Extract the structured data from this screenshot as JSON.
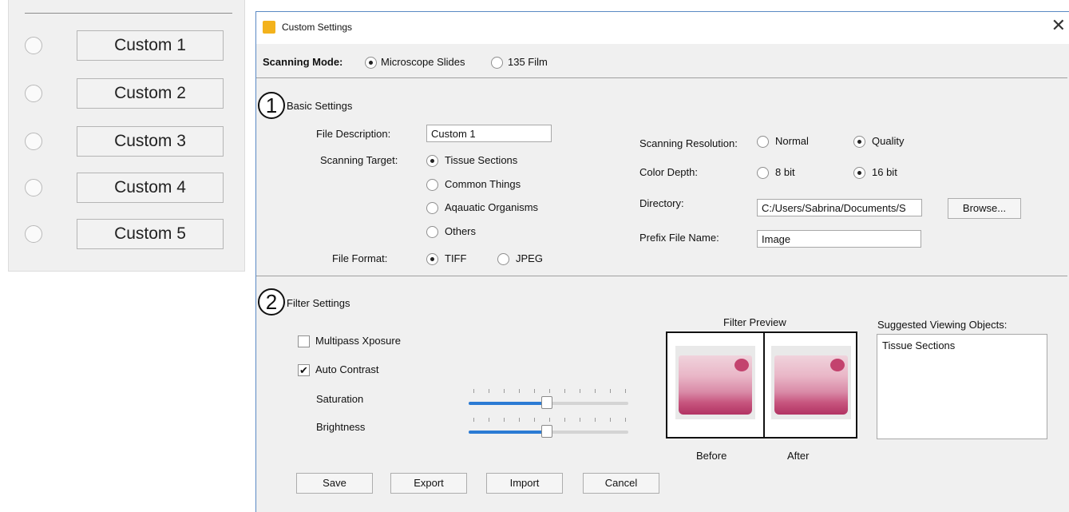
{
  "left_panel": {
    "items": [
      {
        "label": "Custom 1"
      },
      {
        "label": "Custom 2"
      },
      {
        "label": "Custom 3"
      },
      {
        "label": "Custom 4"
      },
      {
        "label": "Custom 5"
      }
    ]
  },
  "dialog": {
    "title": "Custom Settings",
    "close_icon": "close-icon",
    "scanning_mode": {
      "label": "Scanning Mode:",
      "options": [
        "Microscope Slides",
        "135 Film"
      ],
      "selected": "Microscope Slides"
    },
    "basic": {
      "number": "1",
      "title": "Basic Settings",
      "file_description": {
        "label": "File Description:",
        "value": "Custom 1"
      },
      "scanning_target": {
        "label": "Scanning Target:",
        "options": [
          "Tissue Sections",
          "Common Things",
          "Aqauatic Organisms",
          "Others"
        ],
        "selected": "Tissue Sections"
      },
      "file_format": {
        "label": "File Format:",
        "options": [
          "TIFF",
          "JPEG"
        ],
        "selected": "TIFF"
      },
      "scanning_resolution": {
        "label": "Scanning Resolution:",
        "options": [
          "Normal",
          "Quality"
        ],
        "selected": "Quality"
      },
      "color_depth": {
        "label": "Color Depth:",
        "options": [
          "8 bit",
          "16 bit"
        ],
        "selected": "16 bit"
      },
      "directory": {
        "label": "Directory:",
        "value": "C:/Users/Sabrina/Documents/S",
        "browse_label": "Browse..."
      },
      "prefix": {
        "label": "Prefix File Name:",
        "value": "Image"
      }
    },
    "filter": {
      "number": "2",
      "title": "Filter Settings",
      "multipass": {
        "label": "Multipass Xposure",
        "checked": false
      },
      "auto_contrast": {
        "label": "Auto Contrast",
        "checked": true,
        "check_glyph": "✔"
      },
      "saturation": {
        "label": "Saturation",
        "value_fraction": 0.49
      },
      "brightness": {
        "label": "Brightness",
        "value_fraction": 0.49
      },
      "preview_title": "Filter Preview",
      "before_label": "Before",
      "after_label": "After",
      "suggested_label": "Suggested Viewing Objects:",
      "suggested_items": [
        "Tissue Sections"
      ]
    },
    "buttons": {
      "save": "Save",
      "export": "Export",
      "import": "Import",
      "cancel": "Cancel"
    }
  }
}
